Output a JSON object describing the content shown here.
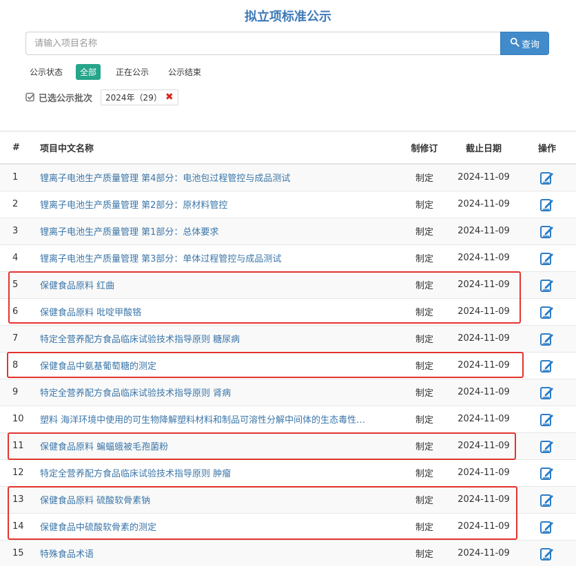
{
  "title": "拟立项标准公示",
  "search": {
    "placeholder": "请输入项目名称",
    "button_label": "查询"
  },
  "status": {
    "label": "公示状态",
    "options": [
      "全部",
      "正在公示",
      "公示结束"
    ],
    "active_index": 0
  },
  "batch": {
    "label": "已选公示批次",
    "tag": "2024年（29）"
  },
  "table": {
    "headers": [
      "#",
      "项目中文名称",
      "制修订",
      "截止日期",
      "操作"
    ],
    "rows": [
      {
        "num": "1",
        "name": "锂离子电池生产质量管理 第4部分：电池包过程管控与成品测试",
        "type": "制定",
        "date": "2024-11-09"
      },
      {
        "num": "2",
        "name": "锂离子电池生产质量管理 第2部分：原材料管控",
        "type": "制定",
        "date": "2024-11-09"
      },
      {
        "num": "3",
        "name": "锂离子电池生产质量管理 第1部分：总体要求",
        "type": "制定",
        "date": "2024-11-09"
      },
      {
        "num": "4",
        "name": "锂离子电池生产质量管理 第3部分：单体过程管控与成品测试",
        "type": "制定",
        "date": "2024-11-09"
      },
      {
        "num": "5",
        "name": "保健食品原料 红曲",
        "type": "制定",
        "date": "2024-11-09"
      },
      {
        "num": "6",
        "name": "保健食品原料 吡啶甲酸铬",
        "type": "制定",
        "date": "2024-11-09"
      },
      {
        "num": "7",
        "name": "特定全营养配方食品临床试验技术指导原则 糖尿病",
        "type": "制定",
        "date": "2024-11-09"
      },
      {
        "num": "8",
        "name": "保健食品中氨基葡萄糖的测定",
        "type": "制定",
        "date": "2024-11-09"
      },
      {
        "num": "9",
        "name": "特定全营养配方食品临床试验技术指导原则 肾病",
        "type": "制定",
        "date": "2024-11-09"
      },
      {
        "num": "10",
        "name": "塑料 海洋环境中使用的可生物降解塑料材料和制品可溶性分解中间体的生态毒性…",
        "type": "制定",
        "date": "2024-11-09"
      },
      {
        "num": "11",
        "name": "保健食品原料 蝙蝠蛾被毛孢菌粉",
        "type": "制定",
        "date": "2024-11-09"
      },
      {
        "num": "12",
        "name": "特定全营养配方食品临床试验技术指导原则 肿瘤",
        "type": "制定",
        "date": "2024-11-09"
      },
      {
        "num": "13",
        "name": "保健食品原料 硫酸软骨素钠",
        "type": "制定",
        "date": "2024-11-09"
      },
      {
        "num": "14",
        "name": "保健食品中硫酸软骨素的测定",
        "type": "制定",
        "date": "2024-11-09"
      },
      {
        "num": "15",
        "name": "特殊食品术语",
        "type": "制定",
        "date": "2024-11-09"
      }
    ]
  },
  "colors": {
    "accent": "#428bca",
    "active_tag": "#26a58a",
    "link": "#3b76a8",
    "highlight": "#e3322d"
  },
  "icons": {
    "search": "search-icon",
    "check": "check-square-icon",
    "remove": "close-icon",
    "edit": "edit-icon"
  }
}
